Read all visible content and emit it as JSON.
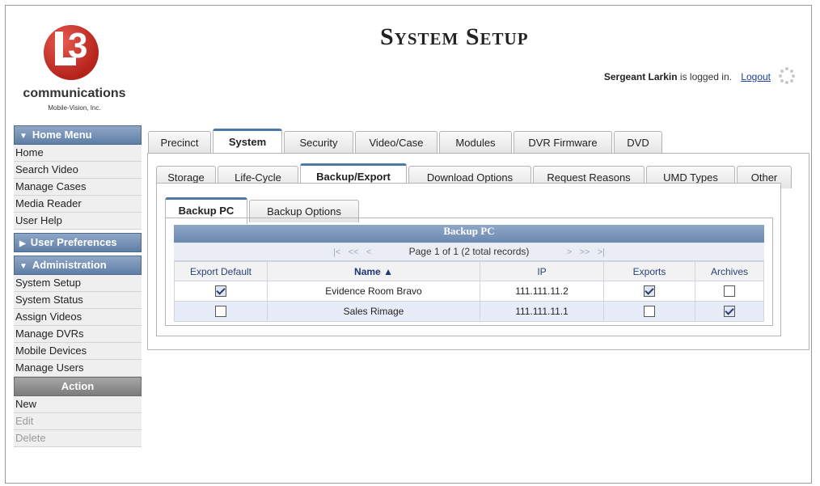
{
  "logo": {
    "brand": "communications",
    "sub": "Mobile-Vision, Inc.",
    "mark": "3"
  },
  "header": {
    "title": "System Setup",
    "user_name": "Sergeant Larkin",
    "logged_in_text": "is logged in.",
    "logout": "Logout"
  },
  "sidebar": {
    "home_menu": {
      "label": "Home Menu",
      "items": [
        "Home",
        "Search Video",
        "Manage Cases",
        "Media Reader",
        "User Help"
      ]
    },
    "user_prefs": {
      "label": "User Preferences"
    },
    "admin": {
      "label": "Administration",
      "items": [
        "System Setup",
        "System Status",
        "Assign Videos",
        "Manage DVRs",
        "Mobile Devices",
        "Manage Users"
      ]
    },
    "action": {
      "label": "Action",
      "items": [
        "New",
        "Edit",
        "Delete"
      ]
    }
  },
  "outer_tabs": [
    "Precinct",
    "System",
    "Security",
    "Video/Case",
    "Modules",
    "DVR Firmware",
    "DVD"
  ],
  "system_tabs": [
    "Storage",
    "Life-Cycle",
    "Backup/Export",
    "Download Options",
    "Request Reasons",
    "UMD Types",
    "Other"
  ],
  "backup_tabs": [
    "Backup PC",
    "Backup Options"
  ],
  "grid": {
    "title": "Backup PC",
    "pager_text": "Page 1 of 1 (2 total records)",
    "columns": [
      "Export Default",
      "Name ▲",
      "IP",
      "Exports",
      "Archives"
    ],
    "rows": [
      {
        "export_default": true,
        "name": "Evidence Room Bravo",
        "ip": "111.111.11.2",
        "exports": true,
        "archives": false
      },
      {
        "export_default": false,
        "name": "Sales Rimage",
        "ip": "111.111.11.1",
        "exports": false,
        "archives": true
      }
    ]
  }
}
